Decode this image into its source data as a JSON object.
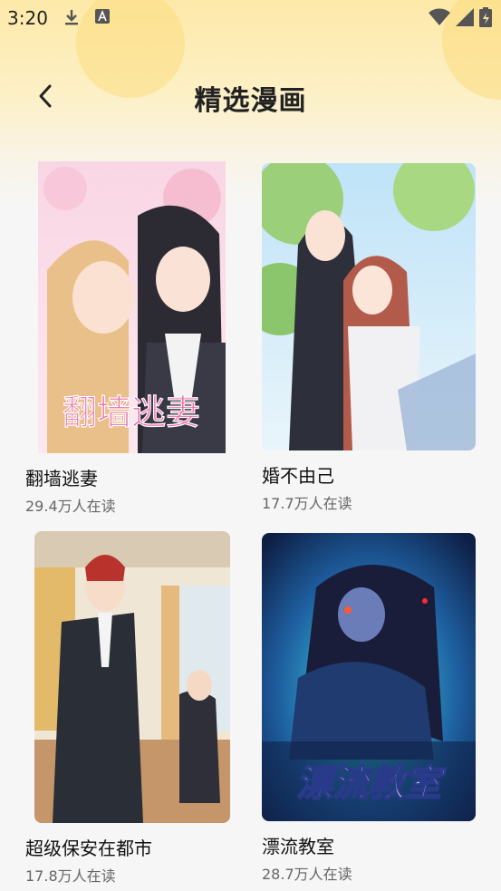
{
  "status_bar": {
    "time": "3:20"
  },
  "header": {
    "title": "精选漫画"
  },
  "comics": [
    {
      "title": "翻墙逃妻",
      "readers": "29.4万人在读",
      "cover_text": "翻墙逃妻",
      "accent": "#f3a6c8"
    },
    {
      "title": "婚不由己",
      "readers": "17.7万人在读",
      "accent": "#8fc0e6"
    },
    {
      "title": "超级保安在都市",
      "readers": "17.8万人在读",
      "accent": "#c8a070"
    },
    {
      "title": "漂流教室",
      "readers": "28.7万人在读",
      "cover_text": "漂流教室",
      "accent": "#1aa6d8"
    }
  ]
}
